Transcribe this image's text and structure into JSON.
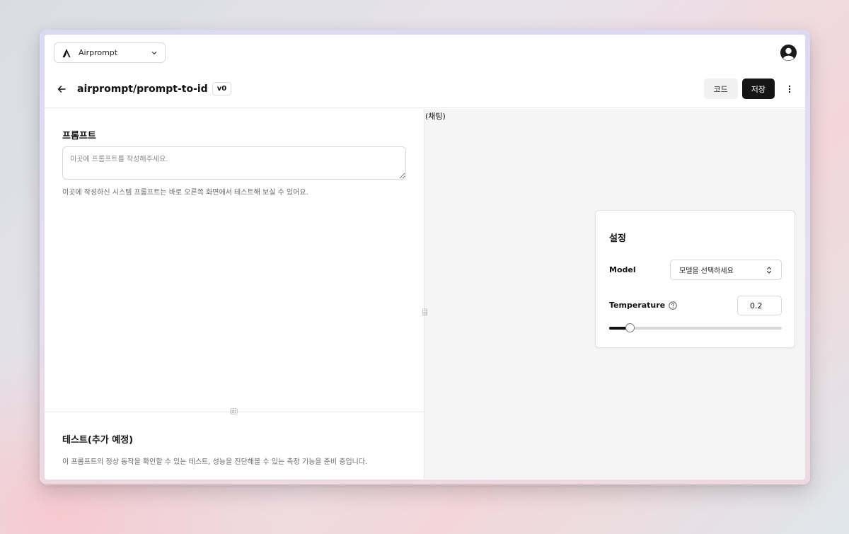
{
  "topbar": {
    "workspace_label": "Airprompt",
    "logo_icon": "airprompt-logo-icon",
    "avatar_icon": "user-avatar-icon"
  },
  "header": {
    "title": "airprompt/prompt-to-id",
    "version": "v0",
    "code_label": "코드",
    "save_label": "저장"
  },
  "prompt": {
    "title": "프롬프트",
    "placeholder": "이곳에 프롬프트를 작성해주세요.",
    "helper": "이곳에 작성하신 시스템 프롬프트는 바로 오른쪽 화면에서 테스트해 보실 수 있어요."
  },
  "test": {
    "title": "테스트(추가 예정)",
    "description": "이 프롬프트의 정상 동작을 확인할 수 있는 테스트, 성능을 진단해볼 수 있는 측정 기능을 준비 중입니다."
  },
  "chat": {
    "label": "(채팅)"
  },
  "settings": {
    "title": "설정",
    "model_label": "Model",
    "model_placeholder": "모델을 선택하세요",
    "temperature_label": "Temperature",
    "temperature_value": "0.2",
    "temperature_fraction": 0.12
  },
  "colors": {
    "primary_button": "#151515",
    "secondary_button": "#f1f1f1",
    "chat_background": "#f5f5f5"
  }
}
